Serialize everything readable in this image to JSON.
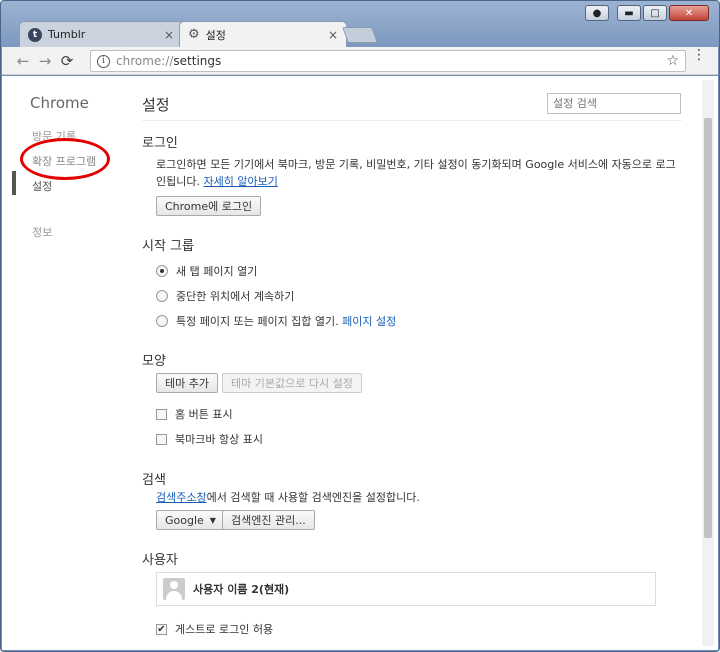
{
  "window": {
    "controls": {
      "user": "●",
      "minimize": "▬",
      "maximize": "□",
      "close": "✕"
    }
  },
  "tabs": [
    {
      "title": "Tumblr",
      "favicon": "t",
      "close": "×"
    },
    {
      "title": "설정",
      "close": "×"
    }
  ],
  "toolbar": {
    "back": "←",
    "forward": "→",
    "reload": "C",
    "url_scheme": "chrome://",
    "url_path": "settings",
    "star": "☆",
    "menu": "⋮"
  },
  "sidebar": {
    "brand": "Chrome",
    "items": [
      {
        "label": "방문 기록"
      },
      {
        "label": "확장 프로그램"
      },
      {
        "label": "설정"
      },
      {
        "label": "정보"
      }
    ]
  },
  "main": {
    "title": "설정",
    "search_placeholder": "설정 검색",
    "signin": {
      "title": "로그인",
      "line1": "로그인하면 모든 기기에서 북마크, 방문 기록, 비밀번호, 기타 설정이 동기화되며 Google 서비스에 자동으로 로그",
      "line2_prefix": "인됩니다.",
      "learn_more": "자세히 알아보기",
      "button": "Chrome에 로그인"
    },
    "startup": {
      "title": "시작 그룹",
      "options": [
        {
          "label": "새 탭 페이지 열기"
        },
        {
          "label": "중단한 위치에서 계속하기"
        },
        {
          "label": "특정 페이지 또는 페이지 집합 열기."
        }
      ],
      "set_pages": "페이지 설정"
    },
    "appearance": {
      "title": "모양",
      "theme_button": "테마 추가",
      "reset_button": "테마 기본값으로 다시 설정",
      "home_button": "홈 버튼 표시",
      "bookmarks_bar": "북마크바 항상 표시"
    },
    "search": {
      "title": "검색",
      "omnibox_link": "검색주소창",
      "desc_suffix": "에서 검색할 때 사용할 검색엔진을 설정합니다.",
      "engine": "Google",
      "manage_button": "검색엔진 관리..."
    },
    "users": {
      "title": "사용자",
      "current_user": "사용자 이름 2(현재)",
      "guest_browsing": "게스트로 로그인 허용",
      "check_mark": "✔"
    }
  },
  "colors": {
    "annotation_circle": "#e30000",
    "link": "#1a5fb4"
  }
}
